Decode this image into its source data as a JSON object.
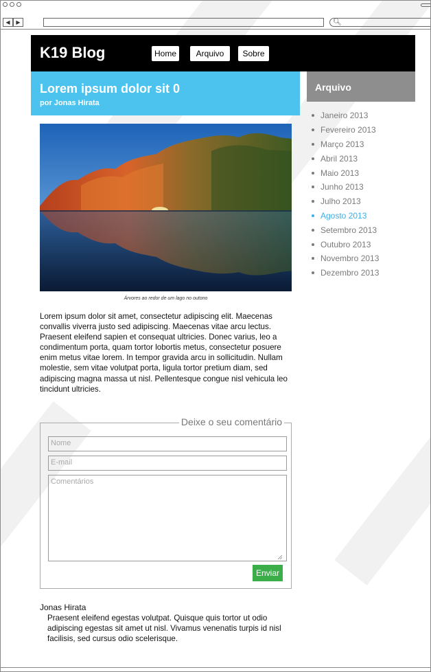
{
  "blog": {
    "title": "K19 Blog"
  },
  "nav": {
    "items": [
      {
        "label": "Home"
      },
      {
        "label": "Arquivo"
      },
      {
        "label": "Sobre"
      }
    ]
  },
  "browser": {
    "search_icon": "search-icon"
  },
  "post": {
    "title": "Lorem ipsum dolor sit 0",
    "author": "por Jonas Hirata",
    "caption": "Árvores ao redor de um lago no outono",
    "body": "Lorem ipsum dolor sit amet, consectetur adipiscing elit. Maecenas convallis viverra justo sed adipiscing. Maecenas vitae arcu lectus. Praesent eleifend sapien et consequat ultricies. Donec varius, leo a condimentum porta, quam tortor lobortis metus, consectetur posuere enim metus vitae lorem. In tempor gravida arcu in sollicitudin. Nullam molestie, sem vitae volutpat porta, ligula tortor pretium diam, sed adipiscing magna massa ut nisl. Pellentesque congue nisl vehicula leo tincidunt ultricies."
  },
  "sidebar": {
    "title": "Arquivo",
    "items": [
      {
        "label": "Janeiro 2013"
      },
      {
        "label": "Fevereiro 2013"
      },
      {
        "label": "Março 2013"
      },
      {
        "label": "Abril 2013"
      },
      {
        "label": "Maio 2013"
      },
      {
        "label": "Junho 2013"
      },
      {
        "label": "Julho 2013"
      },
      {
        "label": "Agosto 2013"
      },
      {
        "label": "Setembro 2013"
      },
      {
        "label": "Outubro 2013"
      },
      {
        "label": "Novembro 2013"
      },
      {
        "label": "Dezembro 2013"
      }
    ],
    "active_index": 7,
    "active_color": "#3aaee8"
  },
  "comment_form": {
    "legend": "Deixe o seu comentário",
    "name_placeholder": "Nome",
    "email_placeholder": "E-mail",
    "comments_placeholder": "Comentários",
    "submit_label": "Enviar"
  },
  "comment": {
    "author": "Jonas Hirata",
    "text": "Praesent eleifend egestas volutpat. Quisque quis tortor ut odio adipiscing egestas sit amet ut nisl. Vivamus venenatis turpis id nisl facilisis, sed cursus odio scelerisque."
  },
  "colors": {
    "header_bg": "#000000",
    "post_header_bg": "#4cc2ef",
    "sidebar_header_bg": "#8e8e8e",
    "submit_bg": "#3bae49"
  }
}
